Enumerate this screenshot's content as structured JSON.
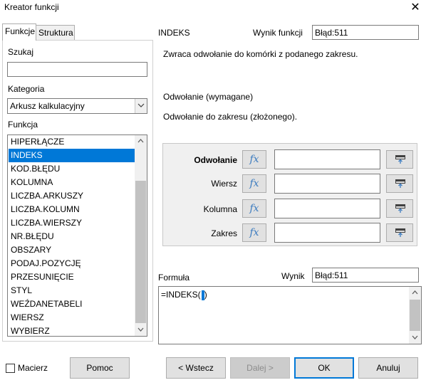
{
  "window": {
    "title": "Kreator funkcji",
    "close_glyph": "✕"
  },
  "tabs": [
    {
      "label": "Funkcje"
    },
    {
      "label": "Struktura"
    }
  ],
  "left": {
    "search_label": "Szukaj",
    "search_value": "",
    "category_label": "Kategoria",
    "category_value": "Arkusz kalkulacyjny",
    "function_label": "Funkcja",
    "functions": [
      "HIPERŁĄCZE",
      "INDEKS",
      "KOD.BŁĘDU",
      "KOLUMNA",
      "LICZBA.ARKUSZY",
      "LICZBA.KOLUMN",
      "LICZBA.WIERSZY",
      "NR.BŁĘDU",
      "OBSZARY",
      "PODAJ.POZYCJĘ",
      "PRZESUNIĘCIE",
      "STYL",
      "WEŹDANETABELI",
      "WIERSZ",
      "WYBIERZ"
    ],
    "selected_function": "INDEKS"
  },
  "right": {
    "function_name": "INDEKS",
    "result_label": "Wynik funkcji",
    "result_value": "Błąd:511",
    "description": "Zwraca odwołanie do komórki z podanego zakresu.",
    "arg_title": "Odwołanie (wymagane)",
    "arg_description": "Odwołanie do zakresu (złożonego).",
    "args": [
      {
        "label": "Odwołanie",
        "value": ""
      },
      {
        "label": "Wiersz",
        "value": ""
      },
      {
        "label": "Kolumna",
        "value": ""
      },
      {
        "label": "Zakres",
        "value": ""
      }
    ],
    "fx_glyph": "fx",
    "formula_label": "Formuła",
    "formula_result_label": "Wynik",
    "formula_result_value": "Błąd:511",
    "formula_text": "=INDEKS(",
    "formula_text_end": ")"
  },
  "footer": {
    "array_label": "Macierz",
    "array_checked": false,
    "help": "Pomoc",
    "back": "< Wstecz",
    "next": "Dalej >",
    "ok": "OK",
    "cancel": "Anuluj"
  },
  "colors": {
    "selection": "#0078d7",
    "fx": "#3b7bbf"
  }
}
